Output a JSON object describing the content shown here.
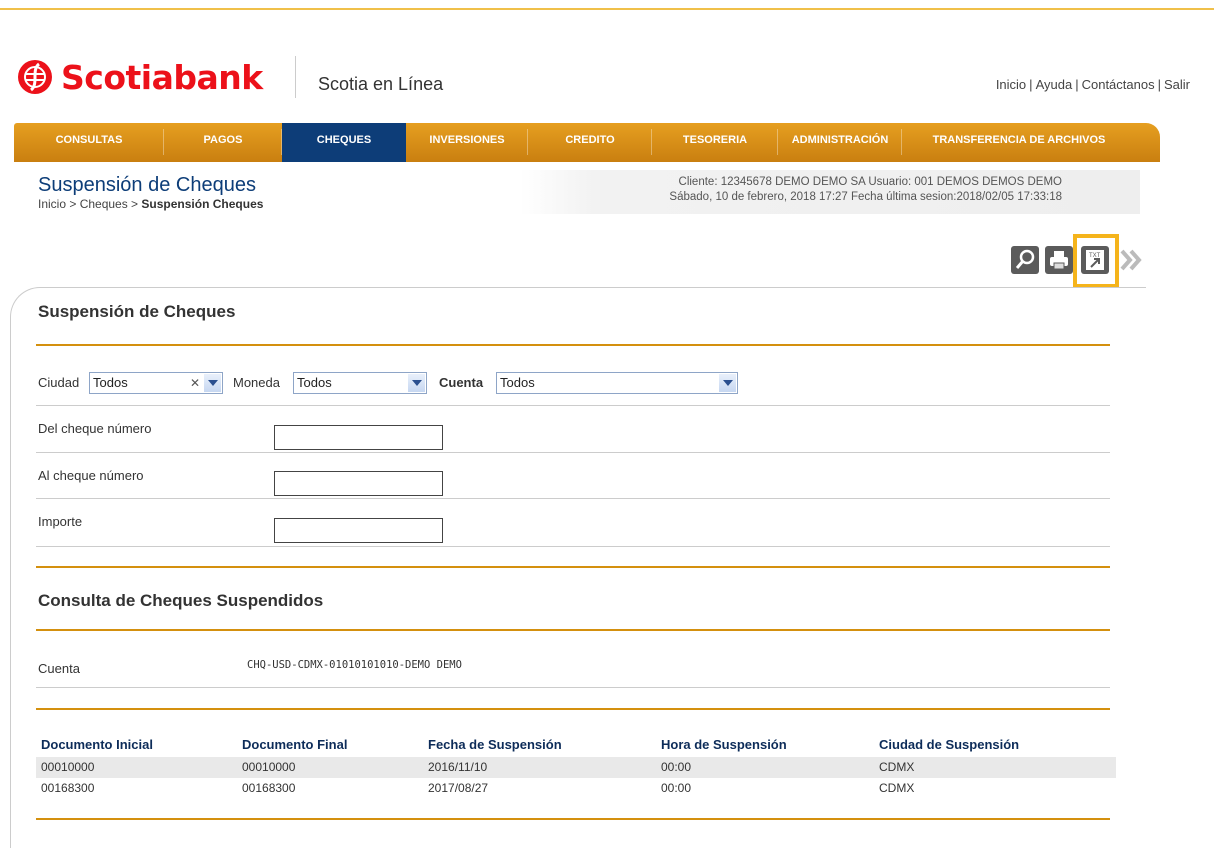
{
  "brand": {
    "name": "Scotiabank",
    "app_name": "Scotia en Línea"
  },
  "top_links": [
    "Inicio",
    "Ayuda",
    "Contáctanos",
    "Salir"
  ],
  "nav": {
    "items": [
      {
        "label": "CONSULTAS"
      },
      {
        "label": "PAGOS"
      },
      {
        "label": "CHEQUES",
        "active": true
      },
      {
        "label": "INVERSIONES"
      },
      {
        "label": "CREDITO"
      },
      {
        "label": "TESORERIA"
      },
      {
        "label": "ADMINISTRACIÓN"
      },
      {
        "label": "TRANSFERENCIA DE ARCHIVOS"
      }
    ]
  },
  "page": {
    "title": "Suspensión de Cheques",
    "breadcrumb_prefix": "Inicio > Cheques > ",
    "breadcrumb_current": "Suspensión Cheques"
  },
  "session": {
    "line1": "Cliente: 12345678 DEMO DEMO SA    Usuario: 001 DEMOS DEMOS DEMO",
    "line2": "Sábado, 10 de febrero, 2018 17:27    Fecha última sesion:2018/02/05 17:33:18"
  },
  "toolbar": {
    "icons": [
      "search-icon",
      "print-icon",
      "txt-export-icon",
      "next-icon"
    ],
    "txt_label": "TXT"
  },
  "form": {
    "section_title": "Suspensión de Cheques",
    "ciudad_label": "Ciudad",
    "ciudad_value": "Todos",
    "moneda_label": "Moneda",
    "moneda_value": "Todos",
    "cuenta_label": "Cuenta",
    "cuenta_value": "Todos",
    "del_label": "Del cheque número",
    "al_label": "Al cheque número",
    "importe_label": "Importe"
  },
  "consulta": {
    "section_title": "Consulta de Cheques Suspendidos",
    "cuenta_label": "Cuenta",
    "cuenta_value": "CHQ-USD-CDMX-01010101010-DEMO DEMO"
  },
  "table": {
    "headers": [
      "Documento Inicial",
      "Documento Final",
      "Fecha de Suspensión",
      "Hora de Suspensión",
      "Ciudad de Suspensión"
    ],
    "rows": [
      [
        "00010000",
        "00010000",
        "2016/11/10",
        "00:00",
        "CDMX"
      ],
      [
        "00168300",
        "00168300",
        "2017/08/27",
        "00:00",
        "CDMX"
      ]
    ]
  },
  "colors": {
    "brand_red": "#ec111a",
    "nav_orange": "#d98d16",
    "nav_active": "#0d3d78",
    "rule": "#d4900e",
    "highlight": "#f5b41b"
  }
}
